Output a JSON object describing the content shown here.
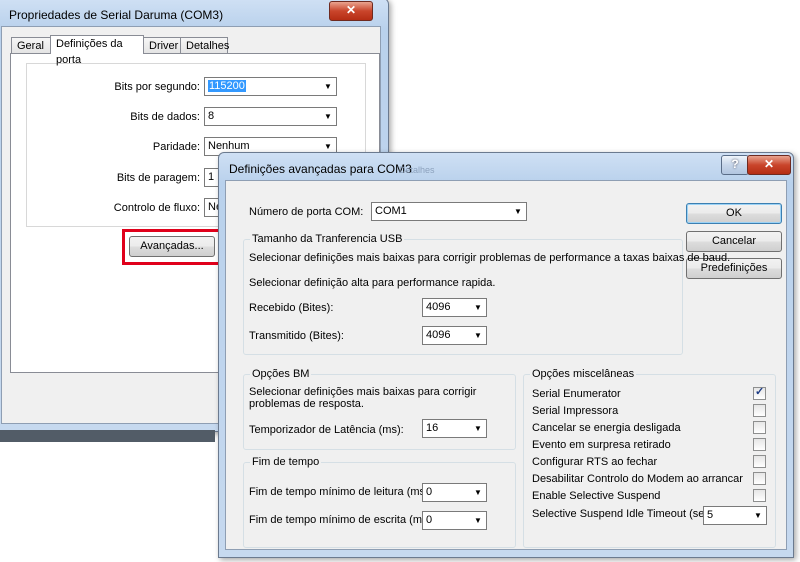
{
  "back_window": {
    "title": "Propriedades de Serial Daruma (COM3)",
    "close": "✕",
    "tabs": [
      "Geral",
      "Definições da porta",
      "Driver",
      "Detalhes"
    ],
    "fields": [
      {
        "label": "Bits por segundo:",
        "value": "115200"
      },
      {
        "label": "Bits de dados:",
        "value": "8"
      },
      {
        "label": "Paridade:",
        "value": "Nenhum"
      },
      {
        "label": "Bits de paragem:",
        "value": "1"
      },
      {
        "label": "Controlo de fluxo:",
        "value": "Ne"
      }
    ],
    "advanced_button": "Avançadas...",
    "tab_peek": "Detalhes"
  },
  "front_window": {
    "title": "Definições avançadas para COM3",
    "help": "?",
    "close": "✕",
    "com_port": {
      "label": "Número de porta COM:",
      "value": "COM1"
    },
    "buttons": {
      "ok": "OK",
      "cancel": "Cancelar",
      "defaults": "Predefinições"
    },
    "usb_group": {
      "title": "Tamanho da Tranferencia USB",
      "text1": "Selecionar definições mais baixas para corrigir problemas de performance a taxas baixas de baud.",
      "text2": "Selecionar definição alta para performance rapida.",
      "received": {
        "label": "Recebido (Bites):",
        "value": "4096"
      },
      "transmitted": {
        "label": "Transmitido (Bites):",
        "value": "4096"
      }
    },
    "bm_group": {
      "title": "Opções BM",
      "text": "Selecionar definições mais baixas para corrigir problemas de resposta.",
      "latency": {
        "label": "Temporizador de Latência (ms):",
        "value": "16"
      }
    },
    "timeout_group": {
      "title": "Fim de tempo",
      "read": {
        "label": "Fim de tempo mínimo de leitura (ms):",
        "value": "0"
      },
      "write": {
        "label": "Fim de tempo mínimo de escrita (ms):",
        "value": "0"
      }
    },
    "misc_group": {
      "title": "Opções miscelâneas",
      "options": [
        {
          "label": "Serial Enumerator",
          "checked": true
        },
        {
          "label": "Serial Impressora",
          "checked": false
        },
        {
          "label": "Cancelar se energia desligada",
          "checked": false
        },
        {
          "label": "Evento em surpresa retirado",
          "checked": false
        },
        {
          "label": "Configurar RTS ao fechar",
          "checked": false
        },
        {
          "label": "Desabilitar Controlo do Modem ao arrancar",
          "checked": false
        },
        {
          "label": "Enable Selective Suspend",
          "checked": false
        }
      ],
      "idle_timeout": {
        "label": "Selective Suspend Idle Timeout (secs):",
        "value": "5"
      }
    }
  },
  "colors": {
    "highlight": "#3399ff",
    "red_box": "#e0001b",
    "close_red": "#c9452b"
  }
}
